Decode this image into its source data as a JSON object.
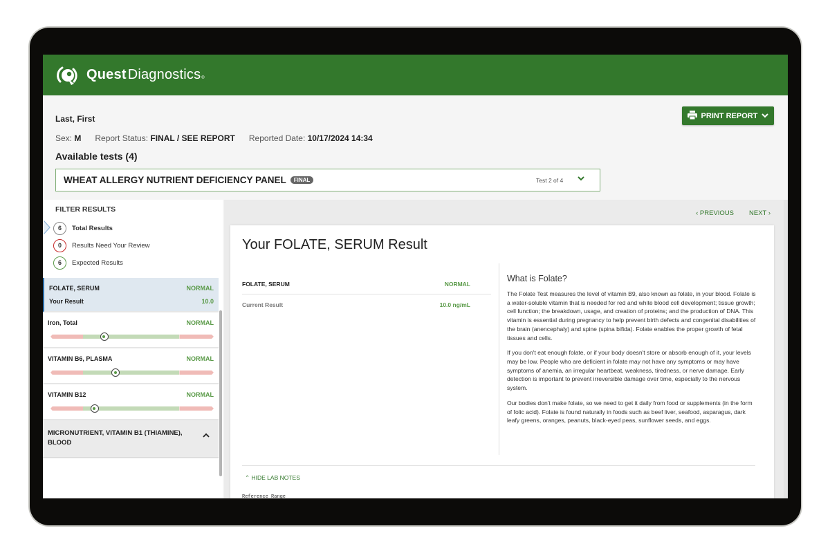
{
  "brand": {
    "name_bold": "Quest",
    "name_light": "Diagnostics",
    "trademark": "®",
    "accent_color": "#33782c"
  },
  "patient": {
    "name": "Last, First",
    "sex_label": "Sex:",
    "sex_value": "M",
    "report_status_label": "Report Status:",
    "report_status_value": "FINAL / SEE REPORT",
    "reported_date_label": "Reported Date:",
    "reported_date_value": "10/17/2024 14:34"
  },
  "available_tests_label": "Available tests (4)",
  "print_button": {
    "label": "PRINT REPORT",
    "icon": "printer-icon"
  },
  "panel_selector": {
    "name": "WHEAT ALLERGY NUTRIENT DEFICIENCY PANEL",
    "badge": "FINAL",
    "count": "Test 2 of 4"
  },
  "filter": {
    "heading": "FILTER RESULTS",
    "items": [
      {
        "count": "6",
        "label": "Total Results",
        "color": "#888888"
      },
      {
        "count": "0",
        "label": "Results Need Your Review",
        "color": "#c62828"
      },
      {
        "count": "6",
        "label": "Expected Results",
        "color": "#5a9a48"
      }
    ]
  },
  "results": [
    {
      "name": "FOLATE, SERUM",
      "status": "NORMAL",
      "sub_label": "Your Result",
      "sub_value": "10.0"
    },
    {
      "name": "Iron, Total",
      "status": "NORMAL",
      "position": 0.33
    },
    {
      "name": "VITAMIN B6, PLASMA",
      "status": "NORMAL",
      "position": 0.4
    },
    {
      "name": "VITAMIN B12",
      "status": "NORMAL",
      "position": 0.27
    }
  ],
  "group": {
    "name": "MICRONUTRIENT, VITAMIN B1 (THIAMINE), BLOOD"
  },
  "nav": {
    "previous": "PREVIOUS",
    "next": "NEXT"
  },
  "detail": {
    "title": "Your FOLATE, SERUM Result",
    "test_name": "FOLATE, SERUM",
    "status": "NORMAL",
    "current_label": "Current Result",
    "current_value": "10.0 ng/mL",
    "info_heading": "What is Folate?",
    "paragraphs": [
      "The Folate Test measures the level of vitamin B9, also known as folate, in your blood. Folate is a water-soluble vitamin that is needed for red and white blood cell development; tissue growth; cell function; the breakdown, usage, and creation of proteins; and the production of DNA. This vitamin is essential during pregnancy to help prevent birth defects and congenital disabilities of the brain (anencephaly) and spine (spina bifida). Folate enables the proper growth of fetal tissues and cells.",
      "If you don't eat enough folate, or if your body doesn't store or absorb enough of it, your levels may be low. People who are deficient in folate may not have any symptoms or may have symptoms of anemia, an irregular heartbeat, weakness, tiredness, or nerve damage. Early detection is important to prevent irreversible damage over time, especially to the nervous system.",
      "Our bodies don't make folate, so we need to get it daily from food or supplements (in the form of folic acid). Folate is found naturally in foods such as beef liver, seafood, asparagus, dark leafy greens, oranges, peanuts, black-eyed peas, sunflower seeds, and eggs."
    ],
    "hide_notes_label": "HIDE LAB NOTES",
    "lab_notes_first_line": "Reference Range"
  }
}
